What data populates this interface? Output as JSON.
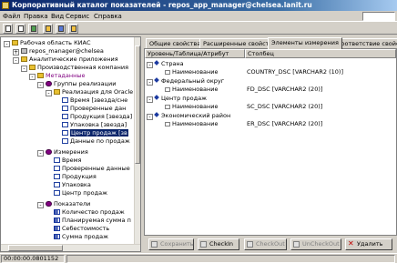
{
  "window": {
    "title": "Корпоративный каталог показателей - repos_app_manager@chelsea.lanit.ru"
  },
  "menu": [
    "Файл",
    "Правка",
    "Вид",
    "Сервис",
    "Справка"
  ],
  "toolbar_icons": [
    "document-icon",
    "page-icon",
    "refresh-icon",
    "box-icon",
    "chart-icon",
    "pyramid-icon"
  ],
  "tree": [
    {
      "label": "Рабочая область КИАС",
      "icon": "folder-icon",
      "expander": "-"
    },
    {
      "label": "repos_manager@chelsea",
      "icon": "database-icon",
      "expander": "+"
    },
    {
      "label": "Аналитические приложения",
      "icon": "folder-icon",
      "expander": "-"
    },
    {
      "label": "Производственная компания",
      "icon": "folder-icon",
      "expander": "-"
    },
    {
      "label": "Метаданные",
      "icon": "folder-icon",
      "expander": "-"
    },
    {
      "label": "Группы реализации",
      "icon": "gear-icon",
      "expander": "-"
    },
    {
      "label": "Реализация для Oracle",
      "icon": "folder-icon",
      "expander": "-"
    },
    {
      "label": "Время [звезда/сне",
      "icon": "cube-icon",
      "expander": ""
    },
    {
      "label": "Проверенные дан",
      "icon": "cube-icon",
      "expander": ""
    },
    {
      "label": "Продукция [звезда]",
      "icon": "cube-icon",
      "expander": ""
    },
    {
      "label": "Упаковка [звезда]",
      "icon": "cube-icon",
      "expander": ""
    },
    {
      "label": "Центр продаж [зв",
      "icon": "cube-icon",
      "expander": ""
    },
    {
      "label": "Данные по продаж",
      "icon": "cube-icon",
      "expander": ""
    },
    {
      "label": "Измерения",
      "icon": "gear-icon",
      "expander": "-"
    },
    {
      "label": "Время",
      "icon": "cube-icon",
      "expander": ""
    },
    {
      "label": "Проверенные данные",
      "icon": "cube-icon",
      "expander": ""
    },
    {
      "label": "Продукция",
      "icon": "cube-icon",
      "expander": ""
    },
    {
      "label": "Упаковка",
      "icon": "cube-icon",
      "expander": ""
    },
    {
      "label": "Центр продаж",
      "icon": "cube-icon",
      "expander": ""
    },
    {
      "label": "Показатели",
      "icon": "gear-icon",
      "expander": "-"
    },
    {
      "label": "Количество продаж",
      "icon": "bars-icon",
      "expander": ""
    },
    {
      "label": "Планируемая сумма п",
      "icon": "bars-icon",
      "expander": ""
    },
    {
      "label": "Себестоимость",
      "icon": "bars-icon",
      "expander": ""
    },
    {
      "label": "Сумма продаж",
      "icon": "bars-icon",
      "expander": ""
    }
  ],
  "tabs": [
    "Общие свойства",
    "Расширенные свойства",
    "Элементы измерения",
    "Соответствие свойств"
  ],
  "active_tab": "Элементы измерения",
  "table": {
    "headers": [
      "Уровень/Таблица/Атрибут",
      "Столбец"
    ],
    "rows": [
      {
        "level": "Страна",
        "attr": "Наименование",
        "column": "COUNTRY_DSC [VARCHAR2 (10)]"
      },
      {
        "level": "Федеральный округ",
        "attr": "Наименование",
        "column": "FD_DSC [VARCHAR2 (20)]"
      },
      {
        "level": "Центр продаж",
        "attr": "Наименование",
        "column": "SC_DSC [VARCHAR2 (20)]"
      },
      {
        "level": "Экономический район",
        "attr": "Наименование",
        "column": "ER_DSC [VARCHAR2 (20)]"
      }
    ]
  },
  "buttons": {
    "save": "Сохранить",
    "checkin": "CheckIn",
    "checkout": "CheckOut",
    "uncheckout": "UnCheckOut",
    "delete": "Удалить"
  },
  "status": {
    "time": "00:00:00.0801152"
  },
  "selected_tree_label": "Центр продаж [зв"
}
